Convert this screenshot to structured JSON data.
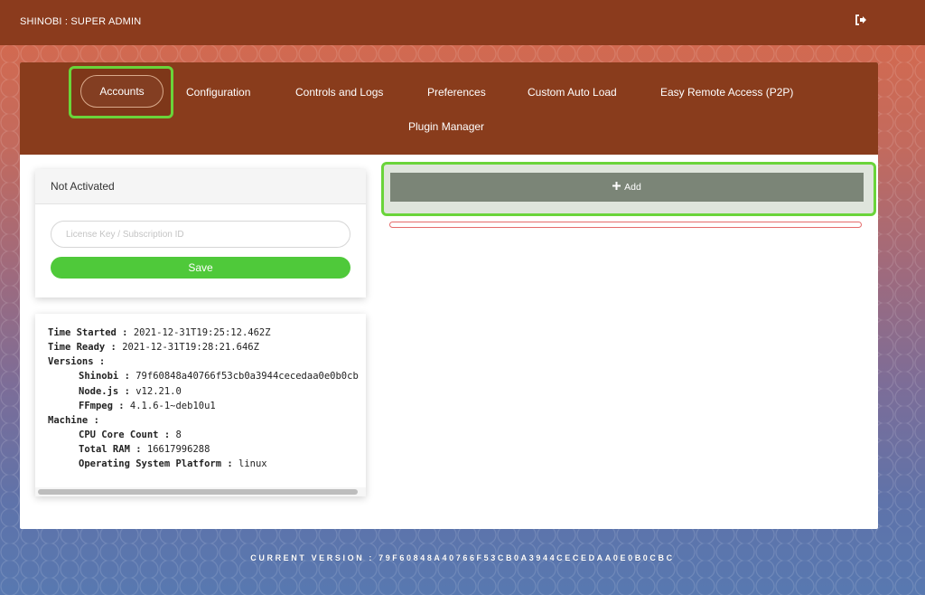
{
  "topbar": {
    "title": "SHINOBI : SUPER ADMIN",
    "logout_icon": "sign-out-icon"
  },
  "nav": {
    "items": [
      {
        "label": "Accounts",
        "active": true
      },
      {
        "label": "Configuration"
      },
      {
        "label": "Controls and Logs"
      },
      {
        "label": "Preferences"
      },
      {
        "label": "Custom Auto Load"
      },
      {
        "label": "Easy Remote Access (P2P)"
      },
      {
        "label": "Plugin Manager"
      }
    ]
  },
  "activation": {
    "status": "Not Activated",
    "placeholder": "License Key / Subscription ID",
    "value": "",
    "save_label": "Save"
  },
  "system_info": {
    "time_started_label": "Time Started :",
    "time_started": "2021-12-31T19:25:12.462Z",
    "time_ready_label": "Time Ready :",
    "time_ready": "2021-12-31T19:28:21.646Z",
    "versions_label": "Versions :",
    "shinobi_label": "Shinobi :",
    "shinobi": "79f60848a40766f53cb0a3944cecedaa0e0b0cb",
    "node_label": "Node.js :",
    "node": "v12.21.0",
    "ffmpeg_label": "FFmpeg :",
    "ffmpeg": "4.1.6-1~deb10u1",
    "machine_label": "Machine :",
    "cpu_label": "CPU Core Count :",
    "cpu": "8",
    "ram_label": "Total RAM :",
    "ram": "16617996288",
    "os_label": "Operating System Platform :",
    "os": "linux"
  },
  "accounts": {
    "add_label": "Add",
    "add_icon": "plus-icon"
  },
  "footer": {
    "version": "CURRENT VERSION : 79F60848A40766F53CB0A3944CECEDAA0E0B0CBC"
  },
  "colors": {
    "topbar": "#8b3b1d",
    "nav": "#893c1c",
    "save": "#4fc93a",
    "add": "#7b8577",
    "highlight": "#6ad43a"
  }
}
